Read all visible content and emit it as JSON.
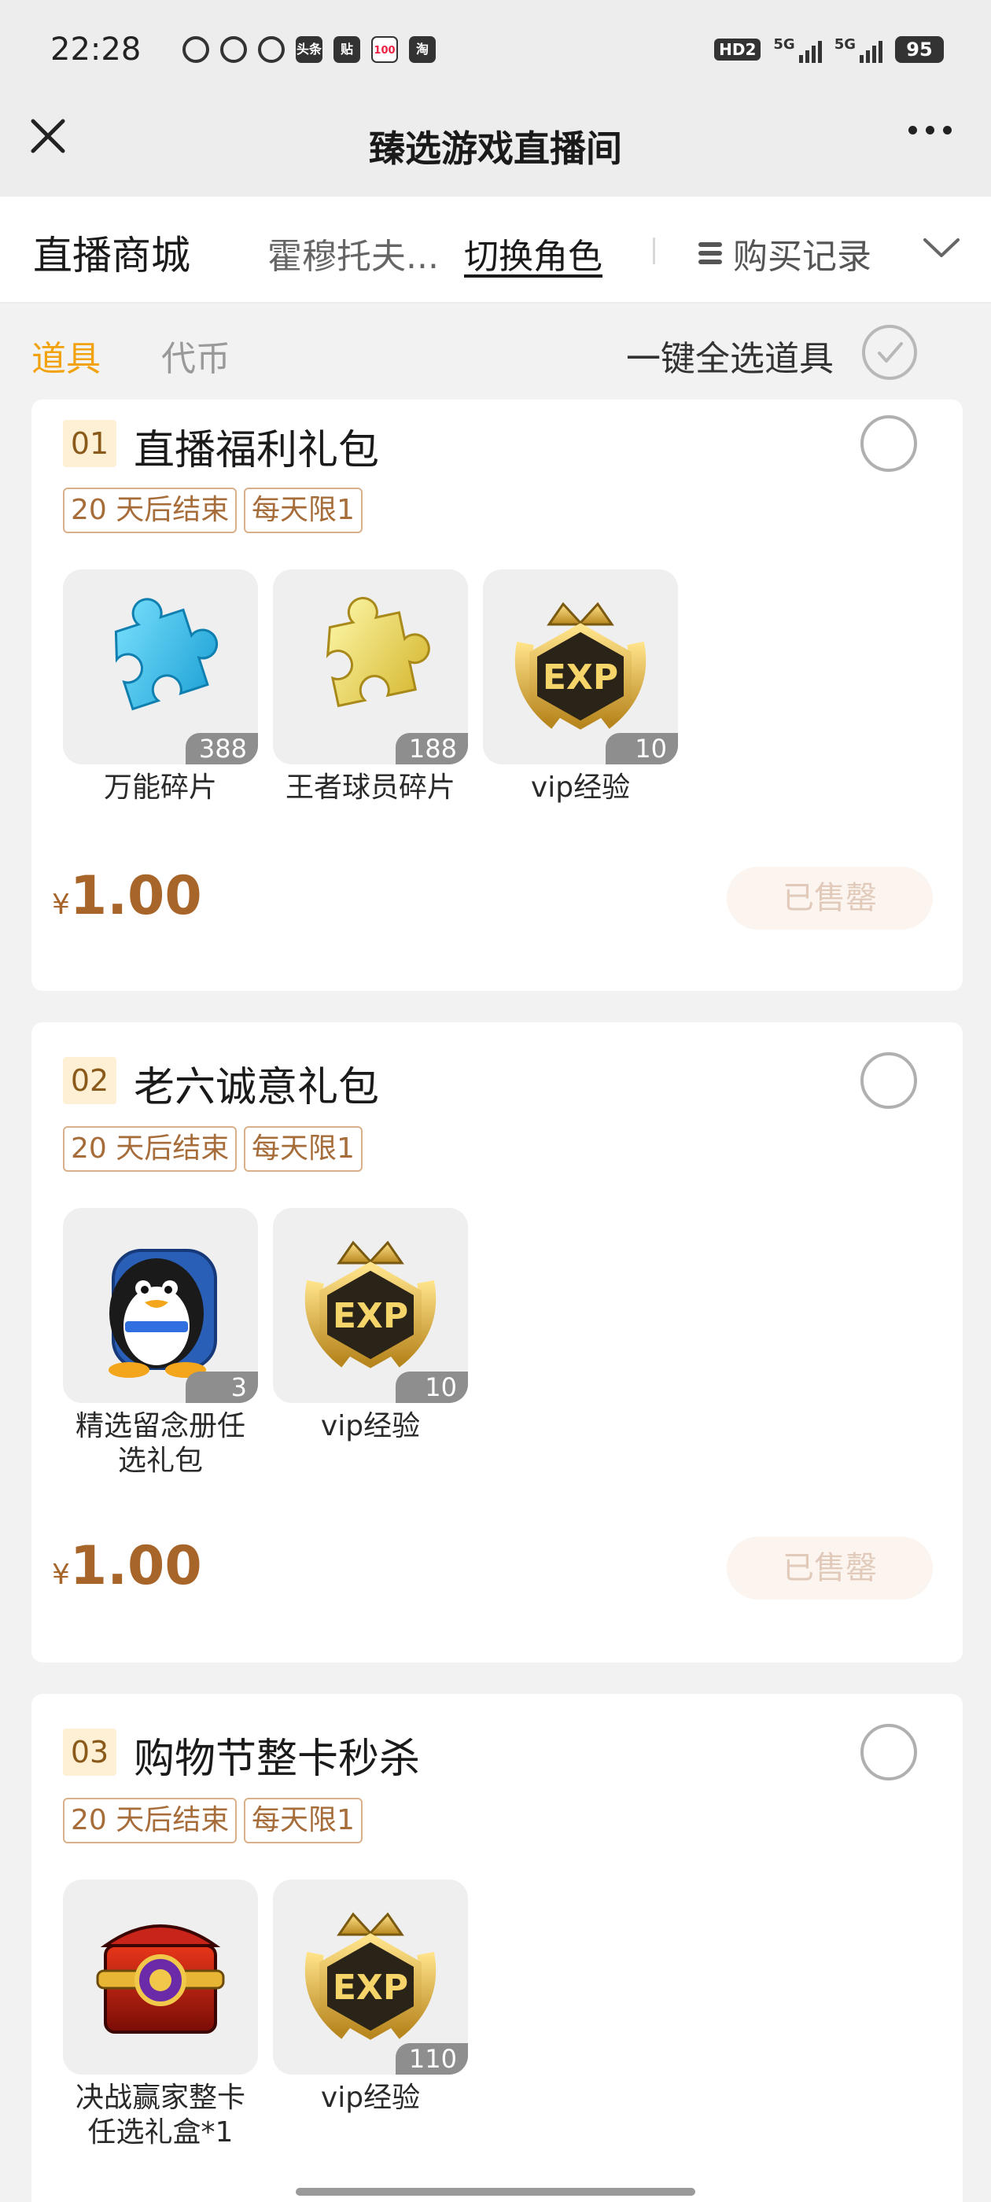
{
  "status_bar": {
    "time": "22:28",
    "apps": [
      "weibo-icon",
      "tiktok-icon",
      "play-icon",
      "toutiao-icon",
      "tieba-icon",
      "hundred-icon",
      "taobao-icon"
    ],
    "app_labels": [
      "",
      "",
      "",
      "头条",
      "贴",
      "100",
      "淘"
    ],
    "hd": "HD2",
    "signal_1": "5G",
    "signal_2": "5G",
    "battery": "95"
  },
  "title_bar": {
    "title": "臻选游戏直播间"
  },
  "header": {
    "title": "直播商城",
    "role": "霍穆托夫...",
    "switch_role": "切换角色",
    "records": "购买记录"
  },
  "tabs": {
    "items": "道具",
    "currency": "代币",
    "select_all": "一键全选道具"
  },
  "colors": {
    "accent": "#f2a20e",
    "price": "#a8652a",
    "tag_border": "#d9b08a",
    "tag_text": "#a66c3a",
    "soldout_bg": "#fbf4ef",
    "soldout_text": "#e2cabb"
  },
  "packages": [
    {
      "num": "01",
      "title": "直播福利礼包",
      "tags": [
        "20 天后结束",
        "每天限1"
      ],
      "items": [
        {
          "icon": "blue-puzzle-icon",
          "qty": "388",
          "name": "万能碎片"
        },
        {
          "icon": "gold-puzzle-icon",
          "qty": "188",
          "name": "王者球员碎片"
        },
        {
          "icon": "exp-badge-icon",
          "qty": "10",
          "name": "vip经验"
        }
      ],
      "currency": "¥",
      "price": "1.00",
      "status": "已售罄"
    },
    {
      "num": "02",
      "title": "老六诚意礼包",
      "tags": [
        "20 天后结束",
        "每天限1"
      ],
      "items": [
        {
          "icon": "penguin-backpack-icon",
          "qty": "3",
          "name": "精选留念册任选礼包"
        },
        {
          "icon": "exp-badge-icon",
          "qty": "10",
          "name": "vip经验"
        }
      ],
      "currency": "¥",
      "price": "1.00",
      "status": "已售罄"
    },
    {
      "num": "03",
      "title": "购物节整卡秒杀",
      "tags": [
        "20 天后结束",
        "每天限1"
      ],
      "items": [
        {
          "icon": "treasure-chest-icon",
          "qty": "",
          "name": "决战赢家整卡任选礼盒*1"
        },
        {
          "icon": "exp-badge-icon",
          "qty": "110",
          "name": "vip经验"
        }
      ]
    }
  ]
}
